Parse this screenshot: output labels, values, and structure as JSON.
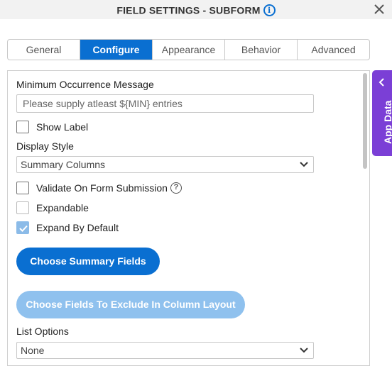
{
  "header": {
    "title": "FIELD SETTINGS - SUBFORM"
  },
  "tabs": [
    {
      "label": "General",
      "active": false
    },
    {
      "label": "Configure",
      "active": true
    },
    {
      "label": "Appearance",
      "active": false
    },
    {
      "label": "Behavior",
      "active": false
    },
    {
      "label": "Advanced",
      "active": false
    }
  ],
  "form": {
    "min_occurrence_label": "Minimum Occurrence Message",
    "min_occurrence_placeholder": "Please supply atleast ${MIN} entries",
    "show_label": {
      "label": "Show Label",
      "checked": false
    },
    "display_style_label": "Display Style",
    "display_style_value": "Summary Columns",
    "validate_on_submit": {
      "label": "Validate On Form Submission",
      "checked": false
    },
    "expandable": {
      "label": "Expandable",
      "checked": false
    },
    "expand_by_default": {
      "label": "Expand By Default",
      "checked": true
    },
    "choose_summary_fields_label": "Choose Summary Fields",
    "choose_exclude_fields_label": "Choose Fields To Exclude In Column Layout",
    "list_options_label": "List Options",
    "list_options_value": "None"
  },
  "side_panel": {
    "label": "App Data"
  },
  "colors": {
    "accent": "#0a6fd1",
    "accent_disabled": "#8fc1ee",
    "app_data": "#7b3fd6"
  }
}
